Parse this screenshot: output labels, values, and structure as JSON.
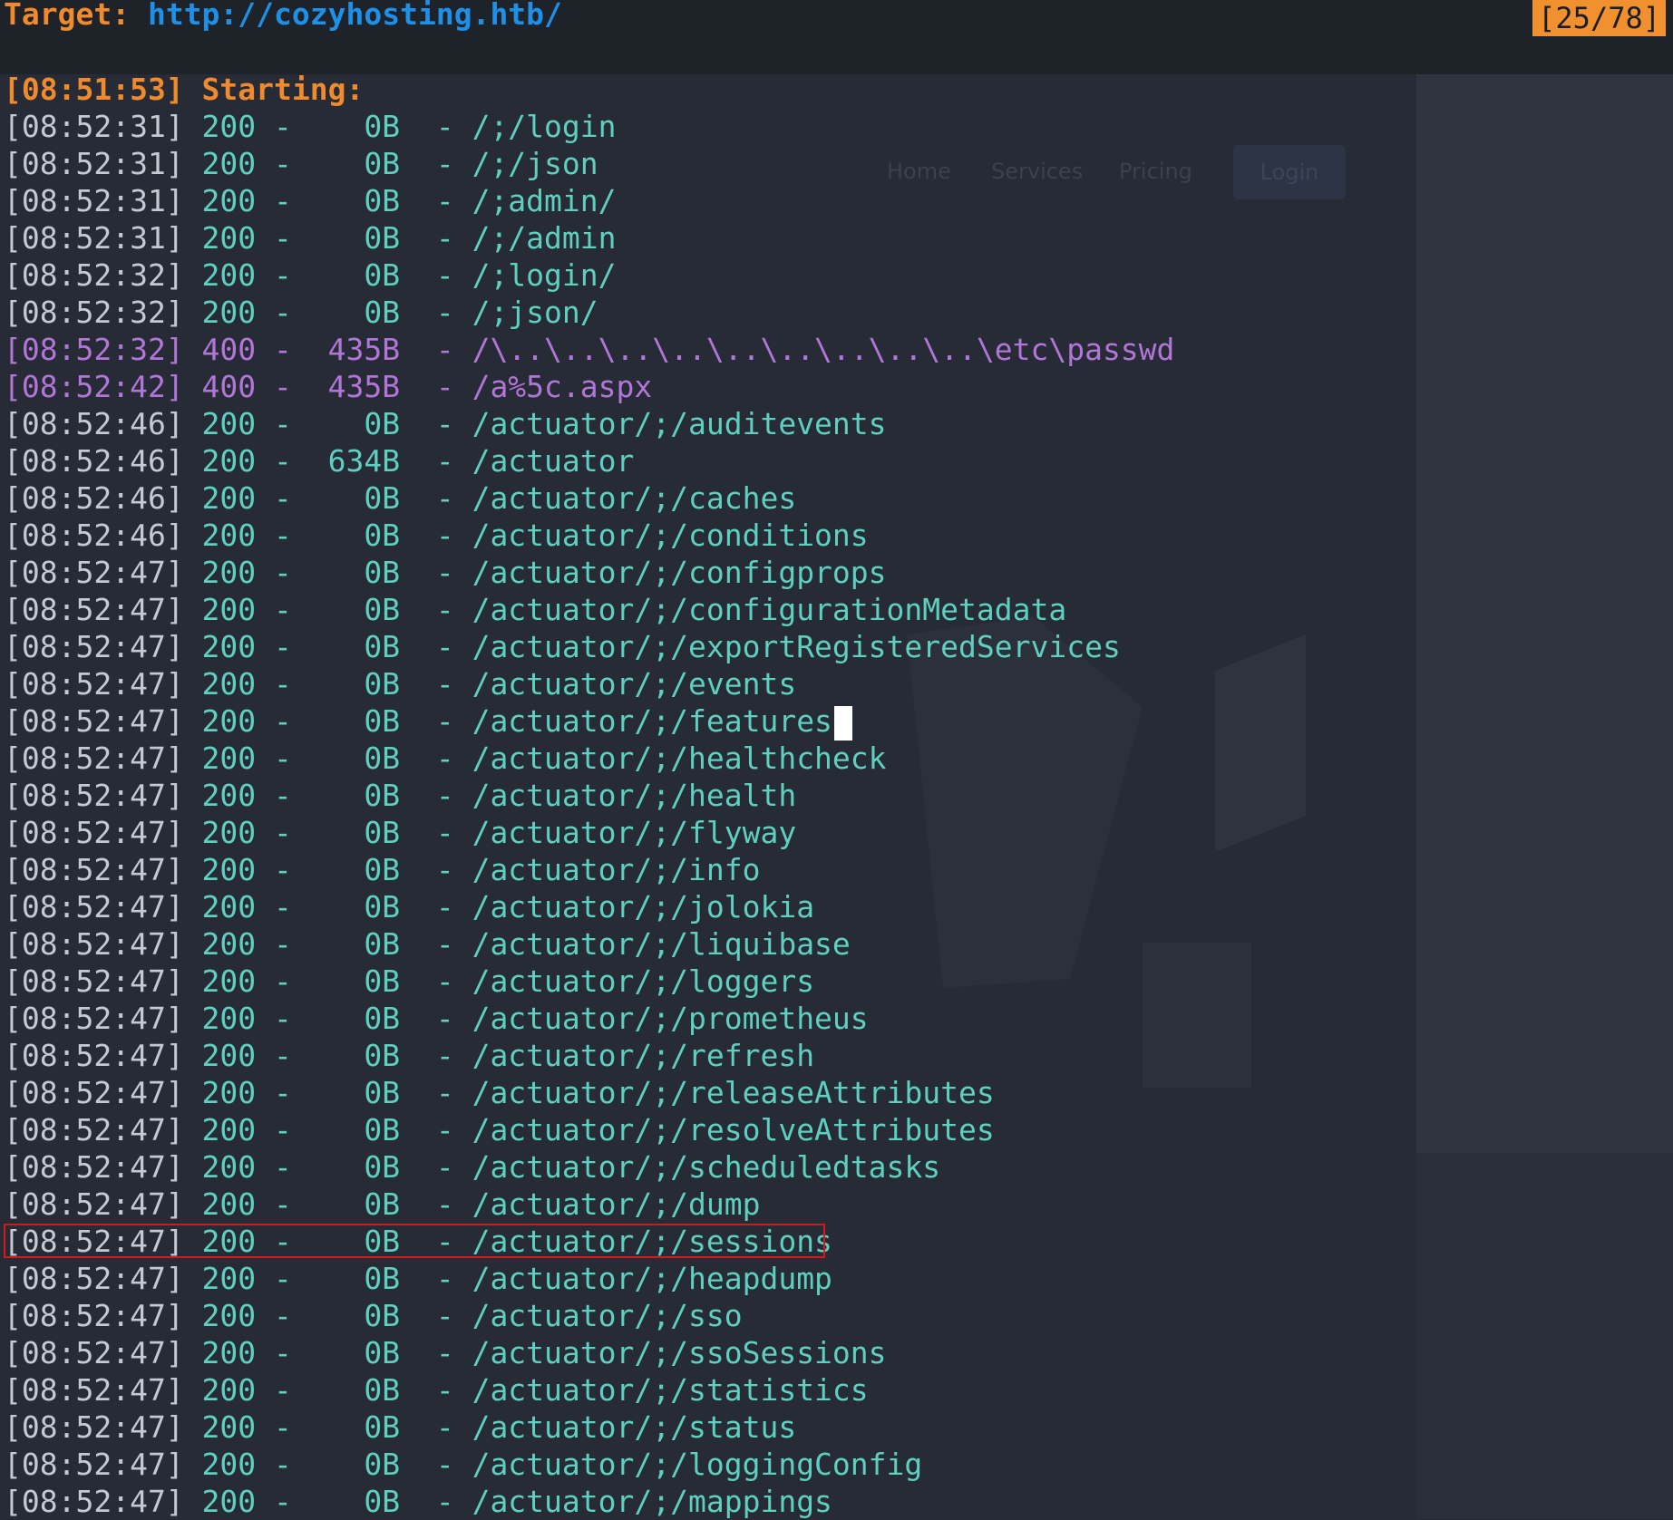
{
  "header": {
    "label": "Target:",
    "url": "http://cozyhosting.htb/",
    "counter": "[25/78]"
  },
  "background_page": {
    "nav_items": [
      "Home",
      "Services",
      "Pricing"
    ],
    "login_button": "Login"
  },
  "log": [
    {
      "ts": "[08:51:53]",
      "text": " Starting:",
      "kind": "start"
    },
    {
      "ts": "[08:52:31]",
      "text": " 200 -    0B  - /;/login",
      "kind": "ok"
    },
    {
      "ts": "[08:52:31]",
      "text": " 200 -    0B  - /;/json",
      "kind": "ok"
    },
    {
      "ts": "[08:52:31]",
      "text": " 200 -    0B  - /;admin/",
      "kind": "ok"
    },
    {
      "ts": "[08:52:31]",
      "text": " 200 -    0B  - /;/admin",
      "kind": "ok"
    },
    {
      "ts": "[08:52:32]",
      "text": " 200 -    0B  - /;login/",
      "kind": "ok"
    },
    {
      "ts": "[08:52:32]",
      "text": " 200 -    0B  - /;json/",
      "kind": "ok"
    },
    {
      "ts": "[08:52:32]",
      "text": " 400 -  435B  - /\\..\\..\\..\\..\\..\\..\\..\\..\\..\\etc\\passwd",
      "kind": "warn"
    },
    {
      "ts": "[08:52:42]",
      "text": " 400 -  435B  - /a%5c.aspx",
      "kind": "warn"
    },
    {
      "ts": "[08:52:46]",
      "text": " 200 -    0B  - /actuator/;/auditevents",
      "kind": "ok"
    },
    {
      "ts": "[08:52:46]",
      "text": " 200 -  634B  - /actuator",
      "kind": "ok"
    },
    {
      "ts": "[08:52:46]",
      "text": " 200 -    0B  - /actuator/;/caches",
      "kind": "ok"
    },
    {
      "ts": "[08:52:46]",
      "text": " 200 -    0B  - /actuator/;/conditions",
      "kind": "ok"
    },
    {
      "ts": "[08:52:47]",
      "text": " 200 -    0B  - /actuator/;/configprops",
      "kind": "ok"
    },
    {
      "ts": "[08:52:47]",
      "text": " 200 -    0B  - /actuator/;/configurationMetadata",
      "kind": "ok"
    },
    {
      "ts": "[08:52:47]",
      "text": " 200 -    0B  - /actuator/;/exportRegisteredServices",
      "kind": "ok"
    },
    {
      "ts": "[08:52:47]",
      "text": " 200 -    0B  - /actuator/;/events",
      "kind": "ok"
    },
    {
      "ts": "[08:52:47]",
      "text": " 200 -    0B  - /actuator/;/features",
      "kind": "ok"
    },
    {
      "ts": "[08:52:47]",
      "text": " 200 -    0B  - /actuator/;/healthcheck",
      "kind": "ok"
    },
    {
      "ts": "[08:52:47]",
      "text": " 200 -    0B  - /actuator/;/health",
      "kind": "ok"
    },
    {
      "ts": "[08:52:47]",
      "text": " 200 -    0B  - /actuator/;/flyway",
      "kind": "ok"
    },
    {
      "ts": "[08:52:47]",
      "text": " 200 -    0B  - /actuator/;/info",
      "kind": "ok"
    },
    {
      "ts": "[08:52:47]",
      "text": " 200 -    0B  - /actuator/;/jolokia",
      "kind": "ok"
    },
    {
      "ts": "[08:52:47]",
      "text": " 200 -    0B  - /actuator/;/liquibase",
      "kind": "ok"
    },
    {
      "ts": "[08:52:47]",
      "text": " 200 -    0B  - /actuator/;/loggers",
      "kind": "ok"
    },
    {
      "ts": "[08:52:47]",
      "text": " 200 -    0B  - /actuator/;/prometheus",
      "kind": "ok"
    },
    {
      "ts": "[08:52:47]",
      "text": " 200 -    0B  - /actuator/;/refresh",
      "kind": "ok"
    },
    {
      "ts": "[08:52:47]",
      "text": " 200 -    0B  - /actuator/;/releaseAttributes",
      "kind": "ok"
    },
    {
      "ts": "[08:52:47]",
      "text": " 200 -    0B  - /actuator/;/resolveAttributes",
      "kind": "ok"
    },
    {
      "ts": "[08:52:47]",
      "text": " 200 -    0B  - /actuator/;/scheduledtasks",
      "kind": "ok"
    },
    {
      "ts": "[08:52:47]",
      "text": " 200 -    0B  - /actuator/;/dump",
      "kind": "ok"
    },
    {
      "ts": "[08:52:47]",
      "text": " 200 -    0B  - /actuator/;/sessions",
      "kind": "ok"
    },
    {
      "ts": "[08:52:47]",
      "text": " 200 -    0B  - /actuator/;/heapdump",
      "kind": "ok"
    },
    {
      "ts": "[08:52:47]",
      "text": " 200 -    0B  - /actuator/;/sso",
      "kind": "ok"
    },
    {
      "ts": "[08:52:47]",
      "text": " 200 -    0B  - /actuator/;/ssoSessions",
      "kind": "ok"
    },
    {
      "ts": "[08:52:47]",
      "text": " 200 -    0B  - /actuator/;/statistics",
      "kind": "ok"
    },
    {
      "ts": "[08:52:47]",
      "text": " 200 -    0B  - /actuator/;/status",
      "kind": "ok"
    },
    {
      "ts": "[08:52:47]",
      "text": " 200 -    0B  - /actuator/;/loggingConfig",
      "kind": "ok"
    },
    {
      "ts": "[08:52:47]",
      "text": " 200 -    0B  - /actuator/;/mappings",
      "kind": "ok"
    }
  ],
  "colors": {
    "accent_orange": "#f08a2e",
    "url_blue": "#1e90e8",
    "ok_teal": "#5fcfc0",
    "warn_purple": "#b275d8",
    "highlight_red": "#d21a1a"
  }
}
